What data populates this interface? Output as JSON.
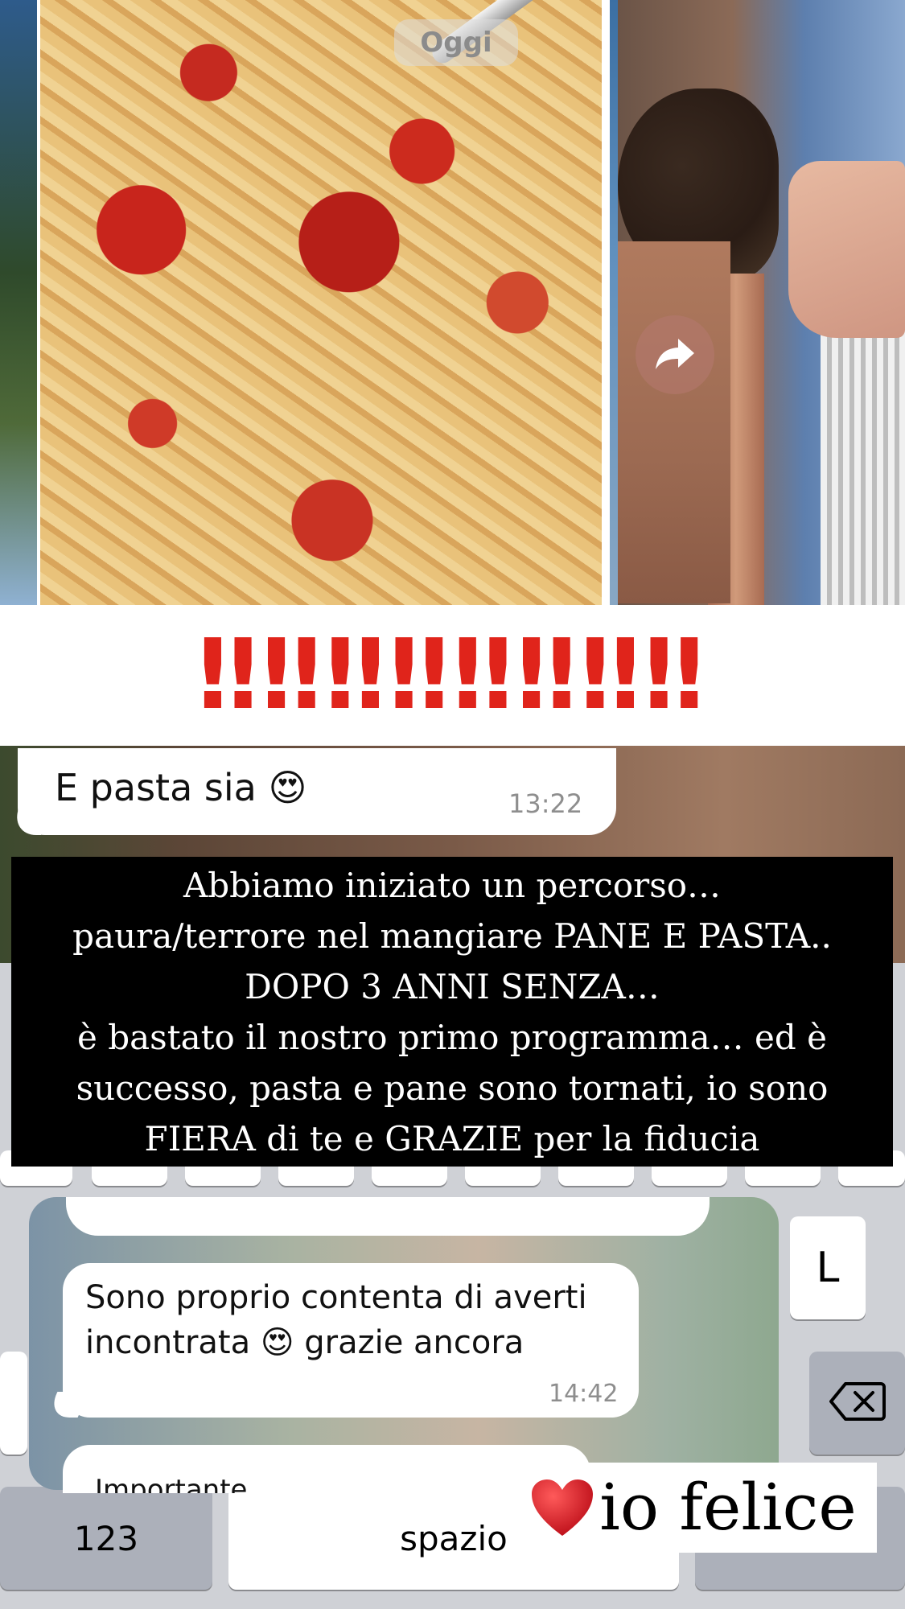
{
  "chat": {
    "date_pill": "Oggi",
    "messages": [
      {
        "text": "E pasta sia 😍",
        "time": "13:22"
      },
      {
        "line1": "Sono proprio contenta di averti",
        "line2": "incontrata 😍 grazie ancora",
        "time": "14:42"
      },
      {
        "text": "Importante"
      }
    ]
  },
  "overlay": {
    "exclamations": "‼‼‼‼‼‼‼‼",
    "caption_lines": [
      "Abbiamo iniziato un percorso…",
      "paura/terrore nel mangiare PANE E PASTA..",
      "DOPO 3 ANNI SENZA…",
      "è bastato il nostro primo programma… ed è",
      "successo, pasta e pane sono tornati, io sono",
      "FIERA di te e GRAZIE per la fiducia"
    ],
    "sticker_text": "io felice"
  },
  "keyboard": {
    "key_l": "L",
    "key_123": "123",
    "key_space": "spazio"
  },
  "colors": {
    "exclamation_red": "#e0241b",
    "caption_bg": "#000000",
    "heart_red": "#d81f26"
  },
  "icons": [
    "forward-icon",
    "backspace-icon",
    "heart-icon"
  ]
}
